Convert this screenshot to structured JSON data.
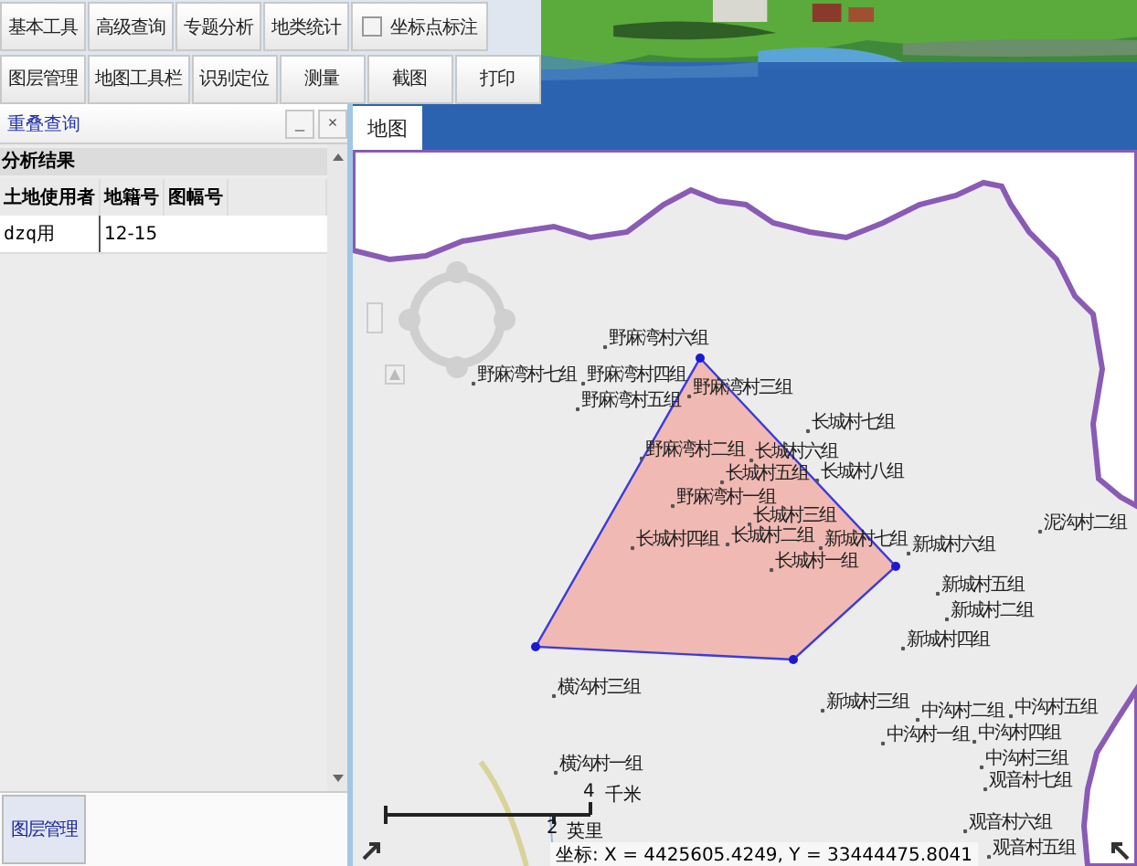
{
  "toolbar": {
    "row_1": [
      {
        "kind": "button",
        "label": "基本工具"
      },
      {
        "kind": "button",
        "label": "高级查询"
      },
      {
        "kind": "button",
        "label": "专题分析"
      },
      {
        "kind": "button",
        "label": "地类统计"
      },
      {
        "kind": "checkbox",
        "label": "坐标点标注",
        "checked": false
      }
    ],
    "row_2": [
      {
        "kind": "button",
        "label": "图层管理"
      },
      {
        "kind": "button",
        "label": "地图工具栏"
      },
      {
        "kind": "button",
        "label": "识别定位"
      },
      {
        "kind": "button",
        "label": "测量"
      },
      {
        "kind": "button",
        "label": "截图"
      },
      {
        "kind": "button",
        "label": "打印"
      }
    ]
  },
  "panel": {
    "title": "重叠查询",
    "minimize": "_",
    "close": "×",
    "section": "分析结果",
    "table": {
      "columns": [
        "土地使用者",
        "地籍号",
        "图幅号"
      ],
      "rows": [
        [
          "dzq用",
          "12-15"
        ]
      ]
    }
  },
  "bottom_tabs": [
    {
      "label": "图层管理",
      "selected": true
    }
  ],
  "map": {
    "tabs": [
      {
        "label": "地图",
        "selected": true
      }
    ],
    "places": [
      "野麻湾村六组",
      "野麻湾村七组",
      "野麻湾村四组",
      "野麻湾村三组",
      "野麻湾村五组",
      "长城村七组",
      "野麻湾村二组",
      "长城村六组",
      "长城村五组",
      "长城村八组",
      "野麻湾村一组",
      "长城村三组",
      "长城村四组",
      "长城村二组",
      "新城村七组",
      "新城村六组",
      "长城村一组",
      "泥沟村二组",
      "新城村五组",
      "新城村二组",
      "新城村四组",
      "横沟村三组",
      "新城村三组",
      "中沟村二组",
      "中沟村五组",
      "中沟村一组",
      "中沟村四组",
      "中沟村三组",
      "横沟村一组",
      "观音村七组",
      "观音村六组",
      "观音村五组"
    ],
    "scale": {
      "km": "4",
      "km_unit": "千米",
      "mi": "2",
      "mi_unit": "英里"
    },
    "coordinates": "坐标: X = 4425605.4249, Y = 33444475.8041"
  }
}
